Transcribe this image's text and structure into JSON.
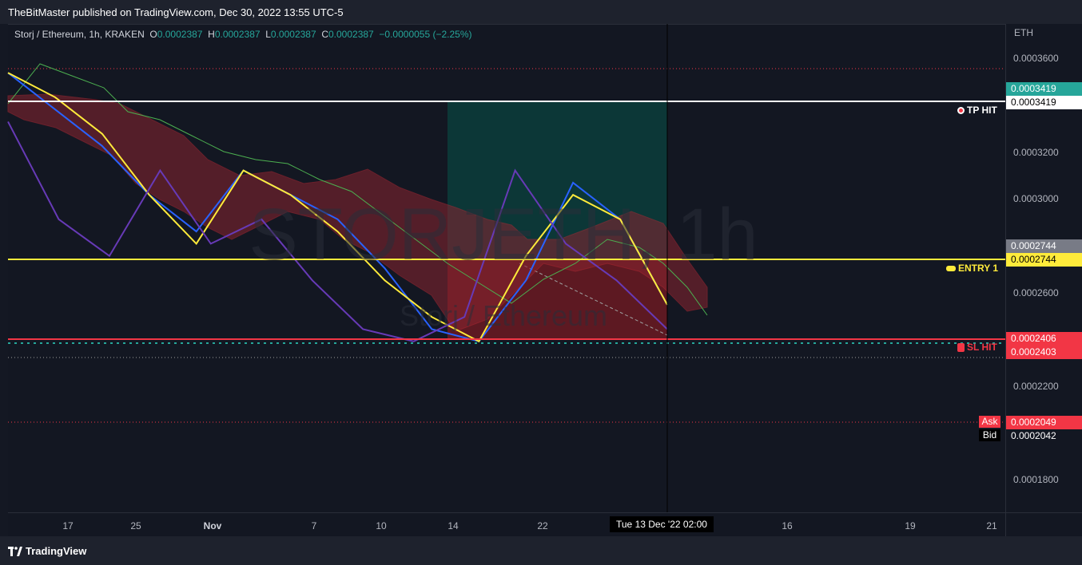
{
  "header": {
    "publisher": "TheBitMaster published on TradingView.com, Dec 30, 2022 13:55 UTC-5"
  },
  "legend": {
    "symbol": "Storj / Ethereum, 1h, KRAKEN",
    "o_label": "O",
    "o_value": "0.0002387",
    "h_label": "H",
    "h_value": "0.0002387",
    "l_label": "L",
    "l_value": "0.0002387",
    "c_label": "C",
    "c_value": "0.0002387",
    "change": "−0.0000055 (−2.25%)"
  },
  "watermark": {
    "line1": "STORJETH, 1h",
    "line2": "Storj / Ethereum"
  },
  "colors": {
    "up": "#26a69a",
    "tp_line": "#ffffff",
    "entry_line": "#ffeb3b",
    "sl_line": "#f23645",
    "tenkan": "#2962ff",
    "kijun": "#ffeb3b",
    "chikou": "#673ab7",
    "cloud_red": "#b22833",
    "cloud_green": "#4caf50"
  },
  "price_axis": {
    "currency": "ETH",
    "ticks": [
      "0.0003600",
      "0.0003200",
      "0.0003000",
      "0.0002600",
      "0.0002200",
      "0.0001800"
    ],
    "labels": {
      "tp_top": "0.0003419",
      "tp": "0.0003419",
      "entry_top": "0.0002744",
      "entry": "0.0002744",
      "sl": "0.0002406",
      "sl2": "0.0002403",
      "ask_label": "Ask",
      "ask": "0.0002049",
      "bid_label": "Bid",
      "bid": "0.0002042"
    }
  },
  "markers": {
    "tp": "TP HIT",
    "entry": "ENTRY 1",
    "sl": "SL HIT"
  },
  "time_axis": {
    "ticks": [
      "17",
      "25",
      "Nov",
      "7",
      "10",
      "14",
      "22",
      "16",
      "19",
      "21"
    ],
    "crosshair": "Tue 13 Dec '22   02:00"
  },
  "footer": {
    "brand": "TradingView"
  },
  "chart_data": {
    "type": "line",
    "title": "Storj / Ethereum, 1h, KRAKEN",
    "ylabel": "ETH",
    "ylim": [
      0.00017,
      0.00037
    ],
    "levels": {
      "take_profit": 0.0003419,
      "entry": 0.0002744,
      "stop_loss": 0.0002406,
      "ask": 0.0002049,
      "bid": 0.0002042
    },
    "series": [
      {
        "name": "Tenkan",
        "values": [
          0.00035,
          0.000335,
          0.00032,
          0.0003,
          0.000285,
          0.00031,
          0.0003,
          0.00029,
          0.00027,
          0.000245,
          0.00024,
          0.000265,
          0.000305,
          0.00029,
          0.000255
        ]
      },
      {
        "name": "Kijun",
        "values": [
          0.00035,
          0.00034,
          0.000325,
          0.0003,
          0.00028,
          0.00031,
          0.0003,
          0.000285,
          0.000265,
          0.00025,
          0.00024,
          0.000275,
          0.0003,
          0.00029,
          0.000255
        ]
      },
      {
        "name": "Chikou",
        "values": [
          0.00033,
          0.00029,
          0.000275,
          0.00031,
          0.00028,
          0.00029,
          0.000265,
          0.000245,
          0.00024,
          0.00025,
          0.00031,
          0.00028,
          0.000265,
          0.000245
        ]
      }
    ]
  }
}
